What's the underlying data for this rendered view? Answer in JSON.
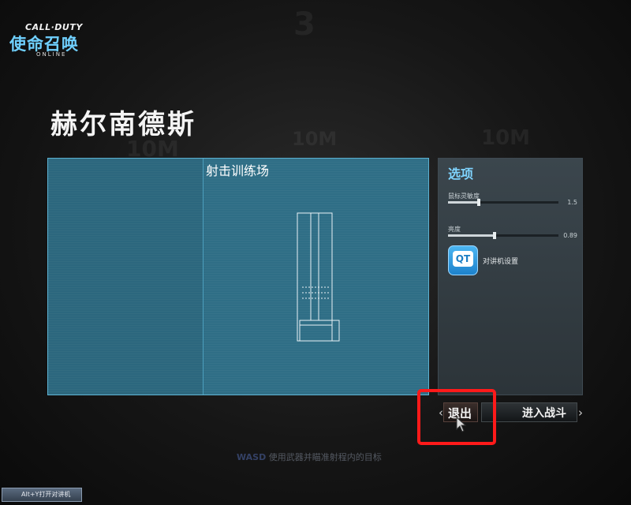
{
  "logo": {
    "top": "CALL·DUTY",
    "main": "使命召唤",
    "sub": "ONLINE"
  },
  "background_marks": [
    "10M",
    "10M",
    "10M",
    "3"
  ],
  "map": {
    "title": "赫尔南德斯",
    "preview_name": "射击训练场"
  },
  "options": {
    "title": "选项",
    "items": [
      {
        "label": "鼠标灵敏度",
        "value": "1.5",
        "fraction": 0.28
      },
      {
        "label": "亮度",
        "value": "0.89",
        "fraction": 0.42
      }
    ],
    "voice_icon_text": "QT",
    "voice_label": "对讲机设置"
  },
  "buttons": {
    "exit": "退出",
    "enter": "进入战斗"
  },
  "hint": {
    "key": "WASD",
    "text": "使用武器并瞄准射程内的目标"
  },
  "voice_shortcut": "Alt+Y打开对讲机",
  "colors": {
    "accent": "#7fd4ff",
    "preview_bg": "#2f6e86",
    "highlight": "#ff1a1a"
  }
}
